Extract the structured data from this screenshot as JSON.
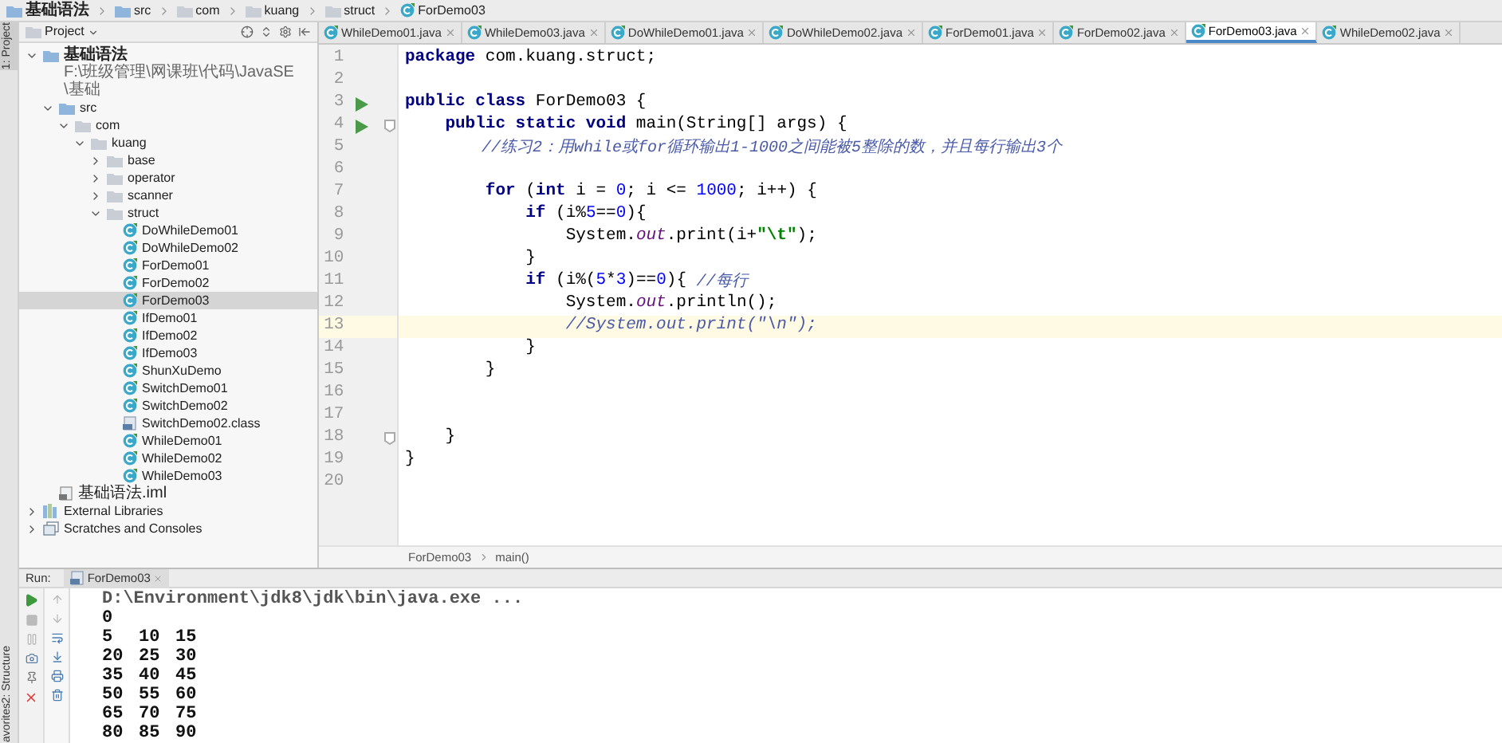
{
  "breadcrumb": [
    {
      "label": "基础语法",
      "kind": "module"
    },
    {
      "label": "src",
      "kind": "source"
    },
    {
      "label": "com",
      "kind": "folder"
    },
    {
      "label": "kuang",
      "kind": "folder"
    },
    {
      "label": "struct",
      "kind": "folder"
    },
    {
      "label": "ForDemo03",
      "kind": "class"
    }
  ],
  "tool_strip": {
    "top": "1: Project",
    "bottom": [
      "2: Structure",
      "avorites"
    ]
  },
  "project": {
    "title": "Project",
    "tree": [
      {
        "label": "基础语法",
        "path": "F:\\班级管理\\网课班\\代码\\JavaSE\\基础",
        "kind": "module",
        "expanded": true,
        "selected": false,
        "children": [
          {
            "label": "src",
            "kind": "source",
            "expanded": true,
            "selected": false,
            "children": [
              {
                "label": "com",
                "kind": "folder",
                "expanded": true,
                "selected": false,
                "children": [
                  {
                    "label": "kuang",
                    "kind": "folder",
                    "expanded": true,
                    "selected": false,
                    "children": [
                      {
                        "label": "base",
                        "kind": "folder",
                        "expanded": false,
                        "selected": false
                      },
                      {
                        "label": "operator",
                        "kind": "folder",
                        "expanded": false,
                        "selected": false
                      },
                      {
                        "label": "scanner",
                        "kind": "folder",
                        "expanded": false,
                        "selected": false
                      },
                      {
                        "label": "struct",
                        "kind": "folder",
                        "expanded": true,
                        "selected": false,
                        "children": [
                          {
                            "label": "DoWhileDemo01",
                            "kind": "class",
                            "selected": false
                          },
                          {
                            "label": "DoWhileDemo02",
                            "kind": "class",
                            "selected": false
                          },
                          {
                            "label": "ForDemo01",
                            "kind": "class",
                            "selected": false
                          },
                          {
                            "label": "ForDemo02",
                            "kind": "class",
                            "selected": false
                          },
                          {
                            "label": "ForDemo03",
                            "kind": "class",
                            "selected": true
                          },
                          {
                            "label": "IfDemo01",
                            "kind": "class",
                            "selected": false
                          },
                          {
                            "label": "IfDemo02",
                            "kind": "class",
                            "selected": false
                          },
                          {
                            "label": "IfDemo03",
                            "kind": "class",
                            "selected": false
                          },
                          {
                            "label": "ShunXuDemo",
                            "kind": "class",
                            "selected": false
                          },
                          {
                            "label": "SwitchDemo01",
                            "kind": "class",
                            "selected": false
                          },
                          {
                            "label": "SwitchDemo02",
                            "kind": "class",
                            "selected": false
                          },
                          {
                            "label": "SwitchDemo02.class",
                            "kind": "classfile",
                            "selected": false
                          },
                          {
                            "label": "WhileDemo01",
                            "kind": "class",
                            "selected": false
                          },
                          {
                            "label": "WhileDemo02",
                            "kind": "class",
                            "selected": false
                          },
                          {
                            "label": "WhileDemo03",
                            "kind": "class",
                            "selected": false
                          }
                        ]
                      }
                    ]
                  }
                ]
              }
            ]
          },
          {
            "label": "基础语法.iml",
            "kind": "iml",
            "selected": false
          }
        ]
      },
      {
        "label": "External Libraries",
        "kind": "library",
        "expanded": false,
        "selected": false
      },
      {
        "label": "Scratches and Consoles",
        "kind": "scratches",
        "expanded": false,
        "selected": false
      }
    ]
  },
  "editor": {
    "tabs": [
      {
        "label": "WhileDemo01.java",
        "selected": false
      },
      {
        "label": "WhileDemo03.java",
        "selected": false
      },
      {
        "label": "DoWhileDemo01.java",
        "selected": false
      },
      {
        "label": "DoWhileDemo02.java",
        "selected": false
      },
      {
        "label": "ForDemo01.java",
        "selected": false
      },
      {
        "label": "ForDemo02.java",
        "selected": false
      },
      {
        "label": "ForDemo03.java",
        "selected": true
      },
      {
        "label": "WhileDemo02.java",
        "selected": false
      }
    ],
    "lines": [
      {
        "number": "1",
        "run": false,
        "fold": false,
        "current": false,
        "tokens": [
          {
            "kind": "keyword",
            "text": "package"
          },
          {
            "kind": "plain",
            "text": " com.kuang.struct;"
          }
        ]
      },
      {
        "number": "2",
        "run": false,
        "fold": false,
        "current": false
      },
      {
        "number": "3",
        "run": true,
        "fold": false,
        "current": false,
        "tokens": [
          {
            "kind": "keyword",
            "text": "public class"
          },
          {
            "kind": "plain",
            "text": " ForDemo03 {"
          }
        ]
      },
      {
        "number": "4",
        "run": true,
        "fold": true,
        "current": false,
        "tokens": [
          {
            "kind": "keyword",
            "text": "    public static void"
          },
          {
            "kind": "plain",
            "text": " main(String[] args) {"
          }
        ]
      },
      {
        "number": "5",
        "run": false,
        "fold": false,
        "current": false,
        "tokens": [
          {
            "kind": "comment",
            "text": "        //练习2：用while或for循环输出1-1000之间能被5整除的数，并且每行输出3个"
          }
        ]
      },
      {
        "number": "6",
        "run": false,
        "fold": false,
        "current": false
      },
      {
        "number": "7",
        "run": false,
        "fold": false,
        "current": false,
        "tokens": [
          {
            "kind": "keyword",
            "text": "        for"
          },
          {
            "kind": "plain",
            "text": " ("
          },
          {
            "kind": "keyword",
            "text": "int"
          },
          {
            "kind": "plain",
            "text": " i = "
          },
          {
            "kind": "number",
            "text": "0"
          },
          {
            "kind": "plain",
            "text": "; i <= "
          },
          {
            "kind": "number",
            "text": "1000"
          },
          {
            "kind": "plain",
            "text": "; i++) {"
          }
        ]
      },
      {
        "number": "8",
        "run": false,
        "fold": false,
        "current": false,
        "tokens": [
          {
            "kind": "keyword",
            "text": "            if"
          },
          {
            "kind": "plain",
            "text": " (i%"
          },
          {
            "kind": "number",
            "text": "5"
          },
          {
            "kind": "plain",
            "text": "=="
          },
          {
            "kind": "number",
            "text": "0"
          },
          {
            "kind": "plain",
            "text": "){"
          }
        ]
      },
      {
        "number": "9",
        "run": false,
        "fold": false,
        "current": false,
        "tokens": [
          {
            "kind": "plain",
            "text": "                System."
          },
          {
            "kind": "field",
            "text": "out"
          },
          {
            "kind": "plain",
            "text": ".print(i+"
          },
          {
            "kind": "string",
            "text": "\"\\t\""
          },
          {
            "kind": "plain",
            "text": ");"
          }
        ]
      },
      {
        "number": "10",
        "run": false,
        "fold": false,
        "current": false,
        "tokens": [
          {
            "kind": "plain",
            "text": "            }"
          }
        ]
      },
      {
        "number": "11",
        "run": false,
        "fold": false,
        "current": false,
        "tokens": [
          {
            "kind": "keyword",
            "text": "            if"
          },
          {
            "kind": "plain",
            "text": " (i%("
          },
          {
            "kind": "number",
            "text": "5"
          },
          {
            "kind": "plain",
            "text": "*"
          },
          {
            "kind": "number",
            "text": "3"
          },
          {
            "kind": "plain",
            "text": ")=="
          },
          {
            "kind": "number",
            "text": "0"
          },
          {
            "kind": "plain",
            "text": "){ "
          },
          {
            "kind": "comment",
            "text": "//每行"
          }
        ]
      },
      {
        "number": "12",
        "run": false,
        "fold": false,
        "current": false,
        "tokens": [
          {
            "kind": "plain",
            "text": "                System."
          },
          {
            "kind": "field",
            "text": "out"
          },
          {
            "kind": "plain",
            "text": ".println();"
          }
        ]
      },
      {
        "number": "13",
        "run": false,
        "fold": false,
        "current": true,
        "tokens": [
          {
            "kind": "comment",
            "text": "                //System.out.print(\"\\n\");"
          }
        ]
      },
      {
        "number": "14",
        "run": false,
        "fold": false,
        "current": false,
        "tokens": [
          {
            "kind": "plain",
            "text": "            }"
          }
        ]
      },
      {
        "number": "15",
        "run": false,
        "fold": false,
        "current": false,
        "tokens": [
          {
            "kind": "plain",
            "text": "        }"
          }
        ]
      },
      {
        "number": "16",
        "run": false,
        "fold": false,
        "current": false
      },
      {
        "number": "17",
        "run": false,
        "fold": false,
        "current": false
      },
      {
        "number": "18",
        "run": false,
        "fold": true,
        "current": false,
        "tokens": [
          {
            "kind": "plain",
            "text": "    }"
          }
        ]
      },
      {
        "number": "19",
        "run": false,
        "fold": false,
        "current": false,
        "tokens": [
          {
            "kind": "plain",
            "text": "}"
          }
        ]
      },
      {
        "number": "20",
        "run": false,
        "fold": false,
        "current": false
      }
    ],
    "breadcrumb": [
      "ForDemo03",
      "main()"
    ]
  },
  "run": {
    "label": "Run:",
    "tab": "ForDemo03",
    "output": [
      {
        "kind": "command",
        "text": "D:\\Environment\\jdk8\\jdk\\bin\\java.exe ..."
      },
      {
        "kind": "values",
        "cells": [
          "0"
        ]
      },
      {
        "kind": "values",
        "cells": [
          "5",
          "10",
          "15"
        ]
      },
      {
        "kind": "values",
        "cells": [
          "20",
          "25",
          "30"
        ]
      },
      {
        "kind": "values",
        "cells": [
          "35",
          "40",
          "45"
        ]
      },
      {
        "kind": "values",
        "cells": [
          "50",
          "55",
          "60"
        ]
      },
      {
        "kind": "values",
        "cells": [
          "65",
          "70",
          "75"
        ]
      },
      {
        "kind": "values",
        "cells": [
          "80",
          "85",
          "90"
        ]
      }
    ]
  }
}
